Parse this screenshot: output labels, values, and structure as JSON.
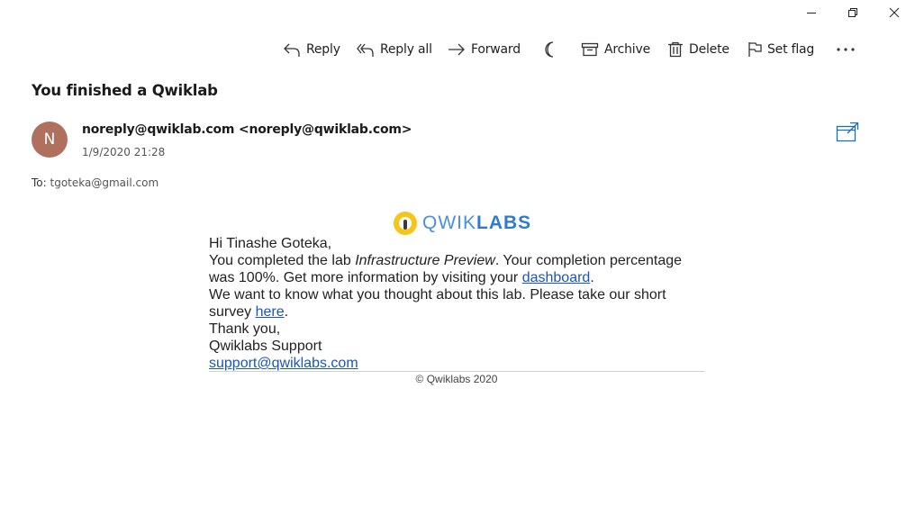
{
  "window": {
    "minimize_icon": "minimize-icon",
    "maximize_icon": "restore-icon",
    "close_icon": "close-icon"
  },
  "toolbar": {
    "reply_label": "Reply",
    "reply_all_label": "Reply all",
    "forward_label": "Forward",
    "archive_label": "Archive",
    "delete_label": "Delete",
    "set_flag_label": "Set flag"
  },
  "message": {
    "subject": "You finished a Qwiklab",
    "avatar_initial": "N",
    "avatar_color": "#b0705e",
    "sender": "noreply@qwiklab.com <noreply@qwiklab.com>",
    "date": "1/9/2020 21:28",
    "to_label": "To:",
    "to_address": "tgoteka@gmail.com"
  },
  "email_body": {
    "logo_text_light": "QWIK",
    "logo_text_bold": "LABS",
    "greeting": "Hi Tinashe Goteka,",
    "line1_prefix": "You completed the lab ",
    "lab_name": "Infrastructure Preview",
    "line1_suffix": ". Your completion percentage was 100%. Get more information by visiting your ",
    "dashboard_link": "dashboard",
    "line1_end": ".",
    "line2_prefix": "We want to know what you thought about this lab. Please take our short survey ",
    "survey_link": "here",
    "line2_end": ".",
    "thanks": "Thank you,",
    "signature": "Qwiklabs Support",
    "support_email": "support@qwiklabs.com",
    "footer": "© Qwiklabs 2020"
  },
  "colors": {
    "link": "#1a56b6",
    "accent": "#1a6fb5",
    "logo_yellow": "#f5c518",
    "logo_blue": "#2f7bd0"
  }
}
